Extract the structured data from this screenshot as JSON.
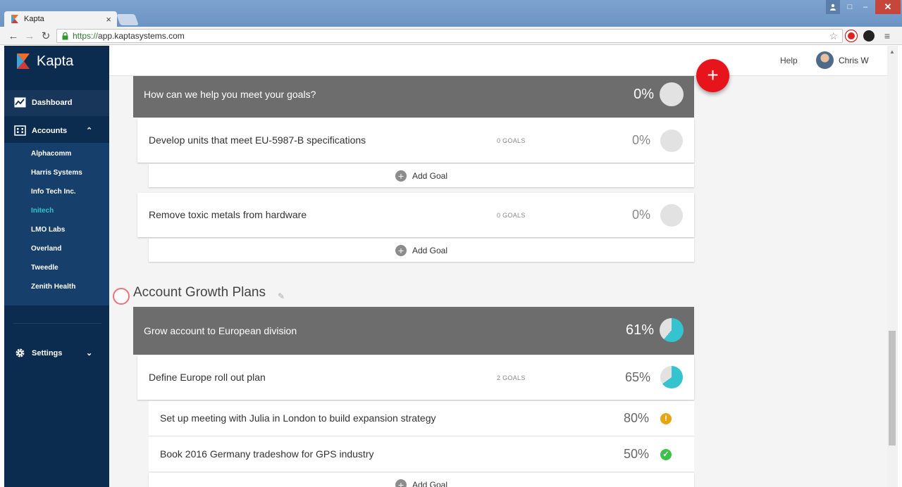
{
  "browser": {
    "tab_title": "Kapta",
    "tab_close": "×",
    "url_scheme": "https://",
    "url_host": "app.kaptasystems.com",
    "back_icon": "←",
    "forward_icon": "→",
    "reload_icon": "↻",
    "star_icon": "☆"
  },
  "window": {
    "minimize": "–",
    "maximize": "□",
    "close": "✕"
  },
  "brand": {
    "name": "Kapta"
  },
  "sidebar": {
    "dashboard": "Dashboard",
    "accounts": "Accounts",
    "accounts_chevron": "⌃",
    "accounts_items": [
      "Alphacomm",
      "Harris Systems",
      "Info Tech Inc.",
      "Initech",
      "LMO Labs",
      "Overland",
      "Tweedle",
      "Zenith Health"
    ],
    "active_account": "Initech",
    "settings": "Settings",
    "settings_chevron": "⌄"
  },
  "header": {
    "help": "Help",
    "user": "Chris W",
    "fab": "+"
  },
  "content": {
    "goal1": {
      "title": "How can we help you meet your goals?",
      "percent": "0%",
      "progress": 0
    },
    "goal1_items": [
      {
        "title": "Develop units that meet EU-5987-B specifications",
        "count": "0 GOALS",
        "percent": "0%",
        "progress": 0
      },
      {
        "title": "Remove toxic metals from hardware",
        "count": "0 GOALS",
        "percent": "0%",
        "progress": 0
      }
    ],
    "add_goal": "Add Goal",
    "add_goal_plus": "+",
    "section_title": "Account Growth Plans",
    "edit_icon": "✎",
    "goal2": {
      "title": "Grow account to European division",
      "percent": "61%",
      "progress": 0.61
    },
    "goal2_item": {
      "title": "Define Europe roll out plan",
      "count": "2 GOALS",
      "percent": "65%",
      "progress": 0.65
    },
    "subgoals": [
      {
        "title": "Set up meeting with Julia in London to build expansion strategy",
        "percent": "80%",
        "status": "warning",
        "status_glyph": "!",
        "color": "#e5a613"
      },
      {
        "title": "Book 2016 Germany tradeshow for GPS industry",
        "percent": "50%",
        "status": "done",
        "status_glyph": "✓",
        "color": "#3ec14c"
      }
    ]
  },
  "colors": {
    "accent": "#35c3d0",
    "fab": "#e8141c",
    "sidebar": "#0c2c4f",
    "goal_header": "#6d6d6d"
  }
}
